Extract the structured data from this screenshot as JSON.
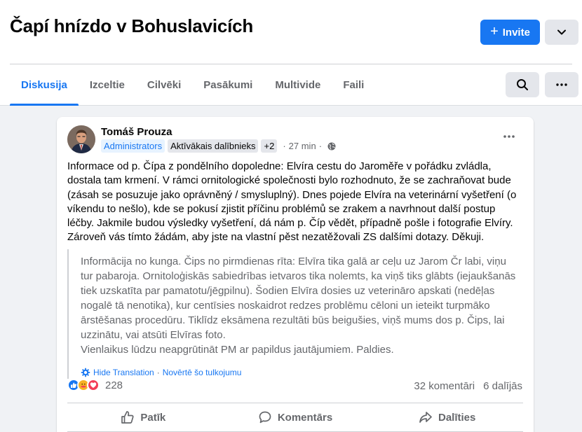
{
  "group": {
    "title": "Čapí hnízdo v Bohuslavicích"
  },
  "header": {
    "invite_label": "Invite"
  },
  "tabs": [
    {
      "label": "Diskusija",
      "active": true
    },
    {
      "label": "Izceltie"
    },
    {
      "label": "Cilvēki"
    },
    {
      "label": "Pasākumi"
    },
    {
      "label": "Multivide"
    },
    {
      "label": "Faili"
    }
  ],
  "post": {
    "author": "Tomáš Prouza",
    "badges": [
      "Administrators",
      "Aktīvākais dalībnieks",
      "+2"
    ],
    "time": "27 min",
    "text": [
      "Informace od p. Čípa z pondělního dopoledne: Elvíra cestu do Jaroměře v pořádku zvládla, dostala tam krmení. V rámci ornitologické společnosti bylo rozhodnuto, že se zachraňovat bude (zásah se posuzuje jako oprávněný / smysluplný). Dnes pojede Elvíra na veterinární vyšetření (o víkendu to nešlo), kde se pokusí zjistit příčinu problémů se zrakem a navrhnout další postup léčby. Jakmile budou výsledky vyšetření, dá nám p. Číp vědět, případně pošle i fotografie Elvíry.",
      "Zároveň vás tímto žádám, aby jste na vlastní pěst nezatěžovali ZS dalšími dotazy. Děkuji."
    ],
    "translation": {
      "text": [
        "Informācija no kunga. Čips no pirmdienas rīta: Elvīra tika galā ar ceļu uz Jarom Čr labi, viņu tur pabaroja. Ornitoloģiskās sabiedrības ietvaros tika nolemts, ka viņš tiks glābts (iejaukšanās tiek uzskatīta par pamatotu/jēgpilnu). Šodien Elvīra dosies uz veterināro apskati (nedēļas nogalē tā nenotika), kur centīsies noskaidrot redzes problēmu cēloni un ieteikt turpmāko ārstēšanas procedūru. Tiklīdz eksāmena rezultāti būs beigušies, viņš mums dos p. Čips, lai uzzinātu, vai atsūti Elvīras foto.",
        "Vienlaikus lūdzu neapgrūtināt PM ar papildus jautājumiem. Paldies."
      ],
      "hide_label": "Hide Translation",
      "rate_label": "Novērtē šo tulkojumu"
    },
    "reaction_count": "228",
    "comments": "32 komentāri",
    "shares": "6 dalījās",
    "actions": {
      "like": "Patīk",
      "comment": "Komentārs",
      "share": "Dalīties"
    }
  },
  "colors": {
    "accent": "#1877f2",
    "like": "#1877f2",
    "love": "#f33e58",
    "care": "#f7b125"
  }
}
